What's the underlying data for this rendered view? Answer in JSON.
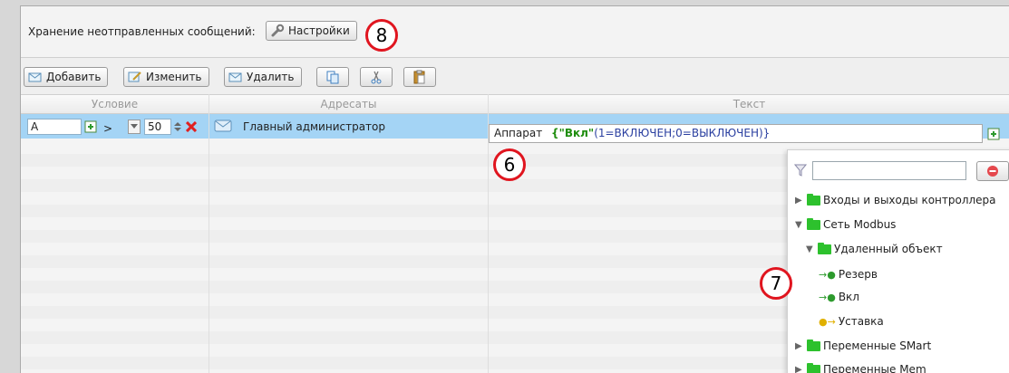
{
  "storage": {
    "label": "Хранение неотправленных сообщений:",
    "settings_button": "Настройки",
    "callout": "8"
  },
  "toolbar": {
    "add": "Добавить",
    "edit": "Изменить",
    "delete": "Удалить"
  },
  "grid": {
    "columns": [
      "Условие",
      "Адресаты",
      "Текст"
    ],
    "row": {
      "condition_var": "A",
      "operator": ">",
      "value": "50",
      "recipient": "Главный администратор",
      "text_prefix": "Аппарат",
      "text_var": "{\"Вкл\"",
      "text_args": "(1=ВКЛЮЧЕН;0=ВЫКЛЮЧЕН)}"
    },
    "callout": "6"
  },
  "tree": {
    "filter_value": "",
    "callout": "7",
    "items": [
      {
        "label": "Входы и выходы контроллера"
      },
      {
        "label": "Сеть Modbus"
      },
      {
        "label": "Удаленный объект"
      },
      {
        "label": "Резерв"
      },
      {
        "label": "Вкл"
      },
      {
        "label": "Уставка"
      },
      {
        "label": "Переменные SMart"
      },
      {
        "label": "Переменные Mem"
      }
    ]
  },
  "colors": {
    "selected_row": "#a4d4f5",
    "callout_ring": "#e0151f",
    "folder": "#2dc12d",
    "template_var": "#1f8d0e"
  }
}
